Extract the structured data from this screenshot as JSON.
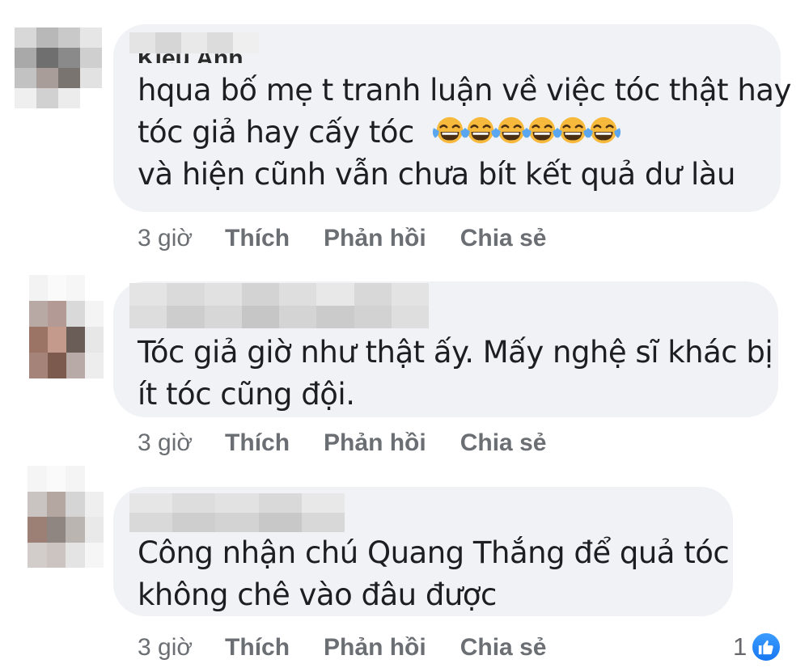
{
  "comments": [
    {
      "name": "Kiều Anh",
      "lines": [
        "hqua bố mẹ t tranh luận về việc tóc thật hay",
        "tóc giả hay cấy tóc",
        "và hiện cũnh vẫn chưa bít kết quả dư làu"
      ],
      "emoji": [
        "face-with-tears-of-joy",
        "face-with-tears-of-joy",
        "face-with-tears-of-joy",
        "face-with-tears-of-joy",
        "face-with-tears-of-joy",
        "face-with-tears-of-joy"
      ],
      "time": "3 giờ",
      "like": "Thích",
      "reply": "Phản hồi",
      "share": "Chia sẻ"
    },
    {
      "lines": [
        "Tóc giả giờ như thật ấy. Mấy nghệ sĩ khác bị",
        "ít tóc cũng đội."
      ],
      "time": "3 giờ",
      "like": "Thích",
      "reply": "Phản hồi",
      "share": "Chia sẻ"
    },
    {
      "lines": [
        "Công nhận chú Quang Thắng để quả tóc",
        "không chê vào đâu được"
      ],
      "time": "3 giờ",
      "like": "Thích",
      "reply": "Phản hồi",
      "share": "Chia sẻ",
      "reaction_count": "1",
      "reaction_icon": "like-thumb-icon"
    }
  ],
  "colors": {
    "bubble": "#f0f2f5",
    "action_text": "#65676b",
    "like_blue": "#1877f2"
  }
}
